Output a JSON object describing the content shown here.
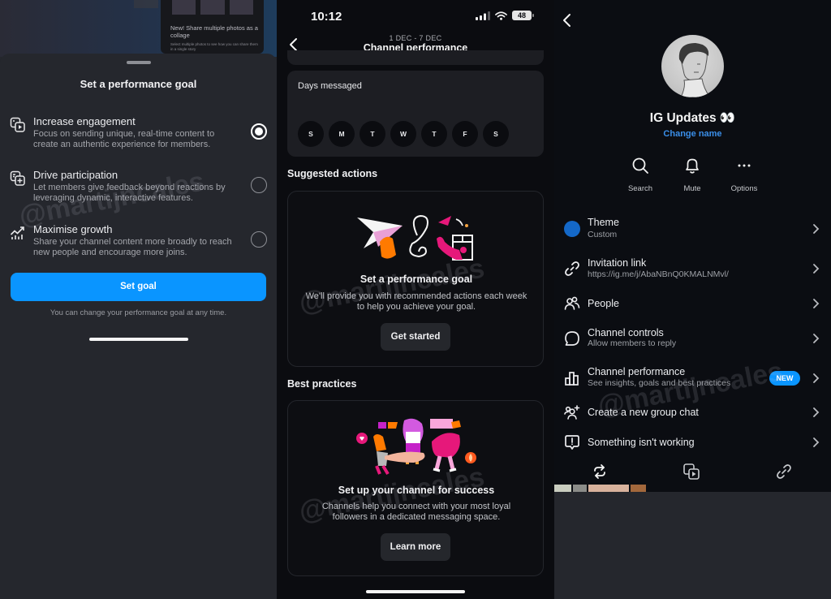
{
  "watermark": "@martijncales",
  "panel1": {
    "background_card": {
      "title": "New! Share multiple photos as a collage",
      "subtitle": "Select multiple photos to see how you can share them in a single story"
    },
    "sheet_title": "Set a performance goal",
    "goals": [
      {
        "icon": "media-collage-icon",
        "title": "Increase engagement",
        "description": "Focus on sending unique, real-time content to create an authentic experience for members.",
        "selected": true
      },
      {
        "icon": "add-content-icon",
        "title": "Drive participation",
        "description": "Let members give feedback beyond reactions by leveraging dynamic, interactive features.",
        "selected": false
      },
      {
        "icon": "growth-chart-icon",
        "title": "Maximise growth",
        "description": "Share your channel content more broadly to reach new people and encourage more joins.",
        "selected": false
      }
    ],
    "set_goal_button": "Set goal",
    "note": "You can change your performance goal at any time.",
    "accent_color": "#0a95ff"
  },
  "panel2": {
    "status_bar": {
      "time": "10:12",
      "battery": "48"
    },
    "header": {
      "date_range": "1 DEC - 7 DEC",
      "title": "Channel performance"
    },
    "days_messaged": {
      "title": "Days messaged",
      "days": [
        "S",
        "M",
        "T",
        "W",
        "T",
        "F",
        "S"
      ]
    },
    "suggested_actions": {
      "section_title": "Suggested actions",
      "card_title": "Set a performance goal",
      "card_description": "We'll provide you with recommended actions each week to help you achieve your goal.",
      "button": "Get started"
    },
    "best_practices": {
      "section_title": "Best practices",
      "card_title": "Set up your channel for success",
      "card_description": "Channels help you connect with your most loyal followers in a dedicated messaging space.",
      "button": "Learn more"
    }
  },
  "panel3": {
    "channel_name": "IG Updates 👀",
    "change_name": "Change name",
    "actions": [
      {
        "icon": "search-icon",
        "label": "Search"
      },
      {
        "icon": "bell-icon",
        "label": "Mute"
      },
      {
        "icon": "more-icon",
        "label": "Options"
      }
    ],
    "rows": [
      {
        "icon": "theme-color-dot",
        "title": "Theme",
        "subtitle": "Custom"
      },
      {
        "icon": "link-icon",
        "title": "Invitation link",
        "subtitle": "https://ig.me/j/AbaNBnQ0KMALNMvl/"
      },
      {
        "icon": "people-icon",
        "title": "People",
        "subtitle": ""
      },
      {
        "icon": "chat-bubble-icon",
        "title": "Channel controls",
        "subtitle": "Allow members to reply"
      },
      {
        "icon": "bar-chart-icon",
        "title": "Channel performance",
        "subtitle": "See insights, goals and best practices",
        "badge": "NEW"
      },
      {
        "icon": "add-group-icon",
        "title": "Create a new group chat",
        "subtitle": ""
      },
      {
        "icon": "alert-bubble-icon",
        "title": "Something isn't working",
        "subtitle": ""
      }
    ],
    "theme_color": "#1468c8",
    "badge_color": "#0a95ff",
    "link_color": "#3a8ee8",
    "tabs": [
      {
        "icon": "repost-icon",
        "active": true
      },
      {
        "icon": "media-icon",
        "active": false
      },
      {
        "icon": "link-icon",
        "active": false
      }
    ]
  }
}
